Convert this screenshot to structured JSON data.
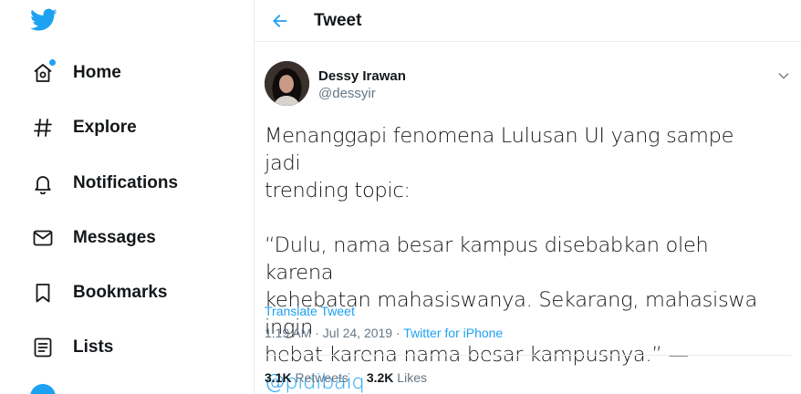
{
  "sidebar": {
    "logo_icon": "twitter-bird-icon",
    "items": [
      {
        "label": "Home",
        "icon": "home-icon",
        "has_badge": true
      },
      {
        "label": "Explore",
        "icon": "hashtag-icon"
      },
      {
        "label": "Notifications",
        "icon": "bell-icon"
      },
      {
        "label": "Messages",
        "icon": "envelope-icon"
      },
      {
        "label": "Bookmarks",
        "icon": "bookmark-icon"
      },
      {
        "label": "Lists",
        "icon": "list-icon"
      }
    ]
  },
  "header": {
    "title": "Tweet",
    "back_icon": "back-arrow-icon"
  },
  "tweet": {
    "author": {
      "name": "Dessy Irawan",
      "handle": "@dessyir"
    },
    "text_line1": "Menanggapi fenomena Lulusan UI yang sampe jadi\ntrending topic:",
    "text_quote": "“Dulu, nama besar kampus disebabkan oleh karena\nkehebatan mahasiswanya. Sekarang, mahasiswa ingin\nhebat karena nama besar kampusnya.” — ",
    "mention": "@pidibaiq",
    "translate_label": "Translate Tweet",
    "time": "1:19 AM · Jul 24, 2019 · ",
    "source": "Twitter for iPhone",
    "retweets_count": "3.1K",
    "retweets_label": "Retweets",
    "likes_count": "3.2K",
    "likes_label": "Likes"
  },
  "colors": {
    "accent": "#1da1f2",
    "text": "#14171a",
    "muted": "#657786",
    "border": "#e6ecf0"
  }
}
